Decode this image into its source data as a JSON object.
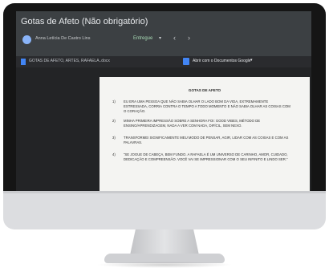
{
  "classroom": {
    "assignment_title": "Gotas de Afeto (Não obrigatório)",
    "student_name": "Anna Letícia De Castro Lins",
    "status": "Entregue",
    "status_dropdown": "▾",
    "prev": "‹",
    "next": "›"
  },
  "file_bar": {
    "file_name": "GOTAS DE AFETO, ARTES, RAFAELA..docx",
    "open_with": "Abrir com o Documentos Google",
    "open_with_dropdown": "▾"
  },
  "document": {
    "title": "GOTAS DE AFETO",
    "items": [
      {
        "num": "1)",
        "text": "EU ERA UMA PESSOA QUE NÃO SABIA OLHAR O LADO BOM DA VIDA, EXTREMAMENTE ESTRESSADA, CORRIA CONTRA O TEMPO A TODO MOMENTO E NÃO SABIA OLHAR AS COISAS COM O CORAÇÃO."
      },
      {
        "num": "2)",
        "text": "MINHA PRIMEIRA IMPRESSÃO SOBRE A SENHORA FOI: GOOD VIBES, MÉTODO DE ENSINO/APRENDIZAGEM, NADA A VER COM NADA, DIFÍCIL, SEM NEXO."
      },
      {
        "num": "3)",
        "text": "TRANSFORMEI SIGNIFICAMENTE MEU MODO DE PENSAR, AGIR, LIDAR COM AS COISAS E COM AS PALAVRAS."
      },
      {
        "num": "4)",
        "text": "“SE JOGUE DE CABEÇA, BEM FUNDO. A RAFAELA É UM UNIVERSO DE CARINHO, AMOR, CUIDADO, DEDICAÇÃO E COMPREENSÃO. VOCÊ VAI SE IMPRESSIONAR COM O SEU INFINITO E LINDO SER.”"
      }
    ]
  },
  "colors": {
    "header_bg": "#3c4043",
    "status_green": "#a8dab5",
    "docs_blue": "#4285f4"
  }
}
